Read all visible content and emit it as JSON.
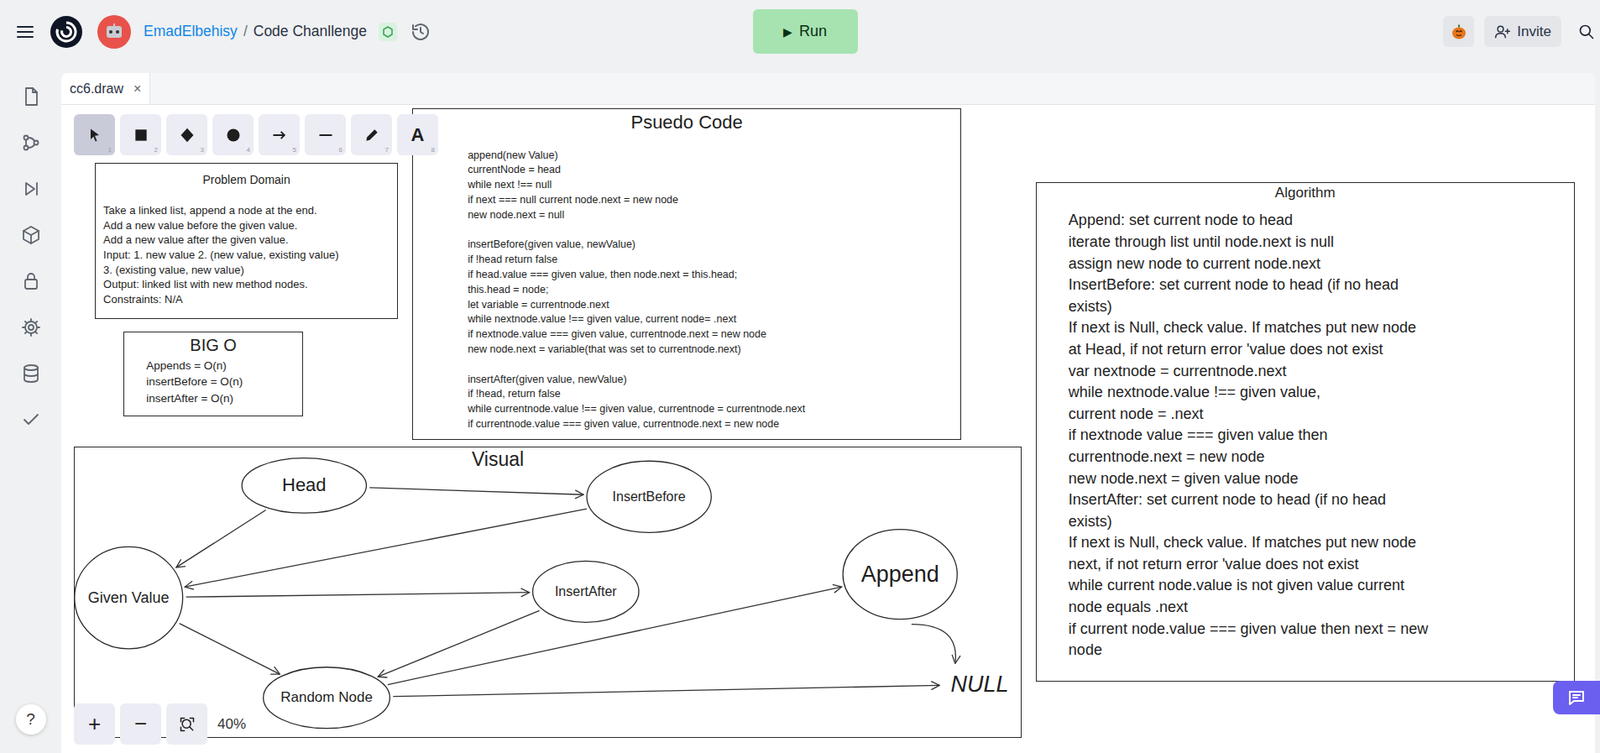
{
  "topbar": {
    "user": "EmadElbehisy",
    "separator": "/",
    "project": "Code Chanllenge",
    "run": {
      "glyph": "▶",
      "label": "Run"
    },
    "invite": "Invite"
  },
  "tabs": [
    {
      "label": "cc6.draw",
      "close": "×",
      "selected": true
    }
  ],
  "help": "?",
  "toolbar": {
    "tools": [
      {
        "kind": "select",
        "key": "1",
        "selected": true
      },
      {
        "kind": "rectangle",
        "key": "2",
        "selected": false
      },
      {
        "kind": "diamond",
        "key": "3",
        "selected": false
      },
      {
        "kind": "ellipse",
        "key": "4",
        "selected": false
      },
      {
        "kind": "arrow",
        "key": "5",
        "selected": false
      },
      {
        "kind": "line",
        "key": "6",
        "selected": false
      },
      {
        "kind": "draw",
        "key": "7",
        "selected": false
      },
      {
        "kind": "text",
        "key": "8",
        "glyph": "A",
        "selected": false
      }
    ]
  },
  "zoom": {
    "zoom_in": "+",
    "zoom_out": "−",
    "percent_text": "40%"
  },
  "diagram": {
    "problem_domain": {
      "title": "Problem Domain",
      "lines": [
        "Take a linked list, append a node at the end.",
        "Add a new value before the given value.",
        "Add a new value after the given value.",
        "Input: 1. new value 2. (new value, existing value)",
        "3. (existing value, new value)",
        "Output: linked list with new method nodes.",
        "Constraints: N/A"
      ]
    },
    "big_o": {
      "title": "BIG O",
      "lines": [
        "Appends = O(n)",
        "insertBefore = O(n)",
        "insertAfter = O(n)"
      ]
    },
    "pseudo_code": {
      "title": "Psuedo Code",
      "sections": [
        [
          "append(new Value)",
          "currentNode = head",
          "while next !== null",
          "if next === null current node.next = new node",
          "new node.next = null"
        ],
        [
          "insertBefore(given value, newValue)",
          "if !head return false",
          "if head.value === given value, then node.next = this.head;",
          "this.head = node;",
          "let variable = currentnode.next",
          "while nextnode.value !== given value, current node= .next",
          "if nextnode.value === given value, currentnode.next = new node",
          "new node.next = variable(that was set to currentnode.next)"
        ],
        [
          "insertAfter(given value, newValue)",
          "if !head, return false",
          "while currentnode.value !== given value, currentnode = currentnode.next",
          "if currentnode.value === given value, currentnode.next = new node"
        ]
      ]
    },
    "algorithm": {
      "title": "Algorithm",
      "lines": [
        "Append: set current node to head",
        "iterate through list until node.next is null",
        "assign new node to current node.next",
        "InsertBefore: set current node to head (if no head",
        "exists)",
        "If next is Null, check value. If matches put new node",
        "at Head, if not return error 'value does not exist",
        "var nextnode = currentnode.next",
        "while nextnode.value !== given value,",
        "current node = .next",
        "if nextnode value === given value then",
        "currentnode.next = new node",
        "new node.next = given value node",
        "InsertAfter: set current node to head (if no head",
        "exists)",
        "If next is Null, check value. If matches put new node",
        "next, if not return error 'value does not exist",
        "while current node.value is not given value current",
        "node equals .next",
        "if current node.value === given value then next = new",
        "node"
      ]
    },
    "visual": {
      "title": "Visual",
      "nodes": [
        {
          "label": "Head",
          "kind": "ellipse"
        },
        {
          "label": "InsertBefore",
          "kind": "ellipse"
        },
        {
          "label": "Given Value",
          "kind": "ellipse"
        },
        {
          "label": "InsertAfter",
          "kind": "ellipse"
        },
        {
          "label": "Append",
          "kind": "ellipse"
        },
        {
          "label": "Random Node",
          "kind": "ellipse"
        },
        {
          "label": "NULL",
          "kind": "text"
        }
      ],
      "edges": [
        {
          "from": 0,
          "to": 1,
          "kind": "straight"
        },
        {
          "from": 0,
          "to": 2,
          "kind": "straight"
        },
        {
          "from": 1,
          "to": 2,
          "kind": "straight"
        },
        {
          "from": 2,
          "to": 3,
          "kind": "straight"
        },
        {
          "from": 2,
          "to": 5,
          "kind": "straight"
        },
        {
          "from": 3,
          "to": 5,
          "kind": "straight"
        },
        {
          "from": 5,
          "to": 4,
          "kind": "straight"
        },
        {
          "from": 5,
          "to": 6,
          "kind": "straight"
        },
        {
          "from": 4,
          "to": 6,
          "kind": "curve"
        }
      ]
    }
  }
}
